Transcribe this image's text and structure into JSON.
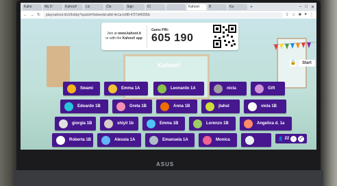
{
  "browser": {
    "tabs": [
      "Kaho",
      "My D",
      "Kahoot!",
      "Lic",
      "Clo",
      "Sign",
      "Cl",
      "",
      "Kahoot",
      "B",
      "Ka",
      ""
    ],
    "url": "play.kahoot.it/v2/lobby?quizId=0ebeedd-a8d-4e1a-b3f8-47f7d4f355fc"
  },
  "lobby": {
    "join_line1": "Join at",
    "join_site": "www.kahoot.it",
    "join_line2": "or with the",
    "join_app": "Kahoot! app",
    "pin_label": "Game PIN:",
    "pin": "605 190",
    "logo": "Kahoot!",
    "start_label": "Start",
    "player_count": "22"
  },
  "players": [
    {
      "name": "Swami",
      "color": "#f7b31b"
    },
    {
      "name": "Emma 1A",
      "color": "#f1c232"
    },
    {
      "name": "Leonardo 1A",
      "color": "#8bc34a"
    },
    {
      "name": "nicla",
      "color": "#9e9e9e"
    },
    {
      "name": "Gift",
      "color": "#ce93d8"
    },
    {
      "name": "Edoardo 1B",
      "color": "#26c6da"
    },
    {
      "name": "Greta 1B",
      "color": "#f48fb1"
    },
    {
      "name": "Anna 1B",
      "color": "#ef6c00"
    },
    {
      "name": "jlahul",
      "color": "#cddc39"
    },
    {
      "name": "viola 1B",
      "color": "#fafafa"
    },
    {
      "name": "giorgia 1B",
      "color": "#e0e0e0"
    },
    {
      "name": "shiyil 1b",
      "color": "#d7ccc8"
    },
    {
      "name": "Emma 1B",
      "color": "#4fc3f7"
    },
    {
      "name": "Lorenzo 1B",
      "color": "#9ccc65"
    },
    {
      "name": "Angelica d. 1a",
      "color": "#ff8a65"
    },
    {
      "name": "Roberta 1B",
      "color": "#ffffff"
    },
    {
      "name": "Alessia 1A",
      "color": "#64b5f6"
    },
    {
      "name": "Emanuela 1A",
      "color": "#b0bec5"
    },
    {
      "name": "Monica",
      "color": "#f06292"
    },
    {
      "name": "",
      "color": "#eceff1"
    }
  ],
  "device": {
    "brand": "ASUS"
  }
}
